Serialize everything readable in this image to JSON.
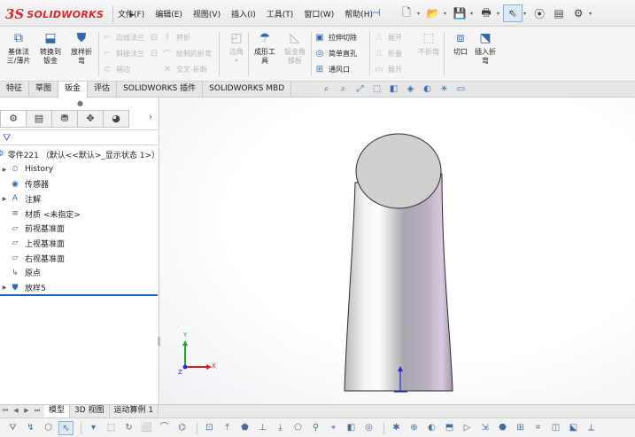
{
  "app": {
    "logo_ds": "3S",
    "logo_name": "SOLIDWORKS",
    "logo_arrow": "▸"
  },
  "menu": [
    "文件(F)",
    "编辑(E)",
    "视图(V)",
    "插入(I)",
    "工具(T)",
    "窗口(W)",
    "帮助(H)"
  ],
  "menu_pin": "⊣",
  "quick_access": [
    {
      "icon": "new-document-icon",
      "glyph": "🗋",
      "caret": true
    },
    {
      "icon": "open-folder-icon",
      "glyph": "📂",
      "caret": true
    },
    {
      "icon": "save-icon",
      "glyph": "💾",
      "caret": true
    },
    {
      "icon": "print-icon",
      "glyph": "🖶",
      "caret": true
    },
    {
      "icon": "select-pointer-icon",
      "glyph": "⇖",
      "caret": true,
      "selected": true
    },
    {
      "icon": "traffic-light-icon",
      "glyph": "⦿",
      "caret": false
    },
    {
      "icon": "file-properties-icon",
      "glyph": "▤",
      "caret": false
    },
    {
      "icon": "options-gear-icon",
      "glyph": "⚙",
      "caret": true
    }
  ],
  "ribbon": {
    "base_flange": "基体法\n三/薄片",
    "convert_to_sheet": "转换到\n钣金",
    "lofted_bend": "放样折\n弯",
    "edge_flange": "边线法兰",
    "fold": "转折",
    "miter_flange": "斜接法兰",
    "sketched_bend": "绘制的折弯",
    "hem": "褶边",
    "cross_break": "交叉-折断",
    "corners": "边角",
    "forming_tool": "成形工\n具",
    "sheet_metal_gusset": "钣金角\n撑板",
    "extruded_cut": "拉伸切除",
    "simple_hole": "简单直孔",
    "vent": "通风口",
    "unfold": "展开",
    "fold2": "折叠",
    "flatten": "展开",
    "no_bends": "不折弯",
    "rip": "切口",
    "insert_bends": "插入折\n弯"
  },
  "tabs": [
    {
      "label": "特征",
      "active": false
    },
    {
      "label": "草图",
      "active": false
    },
    {
      "label": "钣金",
      "active": true
    },
    {
      "label": "评估",
      "active": false
    },
    {
      "label": "SOLIDWORKS 插件",
      "active": false
    },
    {
      "label": "SOLIDWORKS MBD",
      "active": false
    }
  ],
  "headsup": [
    "⌕",
    "⌕",
    "⤢",
    "⬚",
    "◧",
    "◈",
    "◐",
    "☀",
    "▭"
  ],
  "panel": {
    "tab_icons": [
      "⚙",
      "▤",
      "⛃",
      "✥",
      "◕"
    ],
    "next": "›",
    "dot": "●",
    "filter_icon": "⛛"
  },
  "tree": {
    "root": "零件221 （默认<<默认>_显示状态 1>）",
    "items": [
      {
        "label": "History",
        "icon": "history-icon",
        "glyph": "⏲",
        "twisty": "▶"
      },
      {
        "label": "传感器",
        "icon": "sensor-icon",
        "glyph": "◉",
        "twisty": ""
      },
      {
        "label": "注解",
        "icon": "annotations-icon",
        "glyph": "A",
        "twisty": "▶"
      },
      {
        "label": "材质 <未指定>",
        "icon": "material-icon",
        "glyph": "≡",
        "twisty": ""
      },
      {
        "label": "前视基准面",
        "icon": "plane-icon",
        "glyph": "▱",
        "twisty": ""
      },
      {
        "label": "上视基准面",
        "icon": "plane-icon",
        "glyph": "▱",
        "twisty": ""
      },
      {
        "label": "右视基准面",
        "icon": "plane-icon",
        "glyph": "▱",
        "twisty": ""
      },
      {
        "label": "原点",
        "icon": "origin-icon",
        "glyph": "↳",
        "twisty": ""
      },
      {
        "label": "放样5",
        "icon": "loft-feature-icon",
        "glyph": "⛊",
        "twisty": "▶"
      }
    ]
  },
  "triad": {
    "y_label": "Y",
    "x_label": "X",
    "z_label": "Z"
  },
  "bottom_tabs": [
    "模型",
    "3D 视图",
    "运动算例 1"
  ],
  "bottom_nav": [
    "⏮",
    "◀",
    "▶",
    "⏭"
  ],
  "bottom_tools": [
    "⛛",
    "↯",
    "⬡",
    "⇖",
    "▾",
    "⬚",
    "↻",
    "⬜",
    "⌒",
    "⌬",
    "⊡",
    "⤒",
    "⬟",
    "⊥",
    "⤓",
    "⬠",
    "⚲",
    "⌖",
    "◧",
    "◎",
    "✱",
    "⊕",
    "◐",
    "⬒",
    "▷",
    "⇲",
    "⬣",
    "⊞",
    "⌗",
    "◫",
    "⬕",
    "⟂"
  ],
  "colors": {
    "brand_red": "#d4262c",
    "accent_blue": "#1a5fb4",
    "part_gray": "#c9c9c9"
  }
}
